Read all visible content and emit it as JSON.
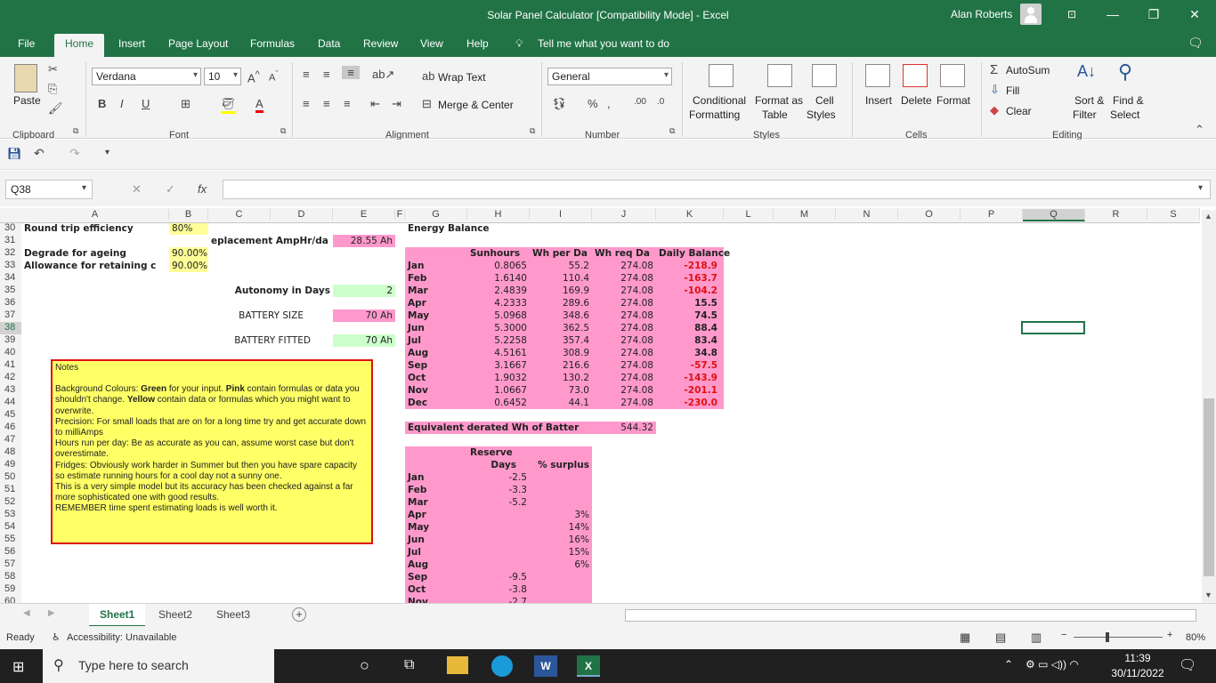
{
  "window": {
    "title": "Solar Panel Calculator  [Compatibility Mode]  -  Excel",
    "user": "Alan Roberts"
  },
  "tabs": [
    "File",
    "Home",
    "Insert",
    "Page Layout",
    "Formulas",
    "Data",
    "Review",
    "View",
    "Help"
  ],
  "tell_me": "Tell me what you want to do",
  "ribbon": {
    "paste": "Paste",
    "clipboard": "Clipboard",
    "font_name": "Verdana",
    "font_size": "10",
    "font": "Font",
    "wrap": "Wrap Text",
    "merge": "Merge & Center",
    "alignment": "Alignment",
    "number_format": "General",
    "number": "Number",
    "cond1": "Conditional",
    "cond2": "Formatting",
    "fmt1": "Format as",
    "fmt2": "Table",
    "cs1": "Cell",
    "cs2": "Styles",
    "styles": "Styles",
    "insert": "Insert",
    "delete": "Delete",
    "format": "Format",
    "cells": "Cells",
    "autosum": "AutoSum",
    "fill": "Fill",
    "clear": "Clear",
    "sort1": "Sort &",
    "sort2": "Filter",
    "find1": "Find &",
    "find2": "Select",
    "editing": "Editing"
  },
  "namebox": "Q38",
  "columns": [
    "A",
    "B",
    "C",
    "D",
    "E",
    "F",
    "G",
    "H",
    "I",
    "J",
    "K",
    "L",
    "M",
    "N",
    "O",
    "P",
    "Q",
    "R",
    "S"
  ],
  "rows": [
    "30",
    "31",
    "32",
    "33",
    "34",
    "35",
    "36",
    "37",
    "38",
    "39",
    "40",
    "41",
    "42",
    "43",
    "44",
    "45",
    "46",
    "47",
    "48",
    "49",
    "50",
    "51",
    "52",
    "53",
    "54",
    "55",
    "56",
    "57",
    "58",
    "59",
    "60"
  ],
  "left": {
    "r30a": "Round trip efficiency",
    "r30b": "80%",
    "r31c": "eplacement AmpHr/da",
    "r31e": "28.55 Ah",
    "r32a": "Degrade for ageing",
    "r32b": "90.00%",
    "r33a": "Allowance for retaining c",
    "r33b": "90.00%",
    "r35d": "Autonomy in Days",
    "r35e": "2",
    "r37d": "BATTERY SIZE",
    "r37e": "70 Ah",
    "r39d": "BATTERY FITTED",
    "r39e": "70 Ah"
  },
  "energy": {
    "title": "Energy  Balance",
    "h_sun": "Sunhours",
    "h_whpd": "Wh per Da",
    "h_whrq": "Wh req Da",
    "h_bal": "Daily Balance",
    "months": [
      "Jan",
      "Feb",
      "Mar",
      "Apr",
      "May",
      "Jun",
      "Jul",
      "Aug",
      "Sep",
      "Oct",
      "Nov",
      "Dec"
    ],
    "sun": [
      "0.8065",
      "1.6140",
      "2.4839",
      "4.2333",
      "5.0968",
      "5.3000",
      "5.2258",
      "4.5161",
      "3.1667",
      "1.9032",
      "1.0667",
      "0.6452"
    ],
    "whpd": [
      "55.2",
      "110.4",
      "169.9",
      "289.6",
      "348.6",
      "362.5",
      "357.4",
      "308.9",
      "216.6",
      "130.2",
      "73.0",
      "44.1"
    ],
    "whrq": [
      "274.08",
      "274.08",
      "274.08",
      "274.08",
      "274.08",
      "274.08",
      "274.08",
      "274.08",
      "274.08",
      "274.08",
      "274.08",
      "274.08"
    ],
    "bal": [
      "-218.9",
      "-163.7",
      "-104.2",
      "15.5",
      "74.5",
      "88.4",
      "83.4",
      "34.8",
      "-57.5",
      "-143.9",
      "-201.1",
      "-230.0"
    ]
  },
  "equiv": {
    "label": "Equivalent derated Wh of Batter",
    "value": "544.32"
  },
  "reserve": {
    "h1": "Reserve",
    "h2": "Days",
    "h3": "% surplus",
    "months": [
      "Jan",
      "Feb",
      "Mar",
      "Apr",
      "May",
      "Jun",
      "Jul",
      "Aug",
      "Sep",
      "Oct",
      "Nov"
    ],
    "days": [
      "-2.5",
      "-3.3",
      "-5.2",
      "",
      "",
      "",
      "",
      "",
      "-9.5",
      "-3.8",
      "-2.7"
    ],
    "surplus": [
      "",
      "",
      "",
      "3%",
      "14%",
      "16%",
      "15%",
      "6%",
      "",
      "",
      ""
    ]
  },
  "notes": {
    "title": "Notes",
    "p1a": "Background Colours: ",
    "p1g": "Green",
    "p1b": " for your input. ",
    "p1p": "Pink",
    "p1c": " contain formulas or data you shouldn't change. ",
    "p1y": "Yellow",
    "p1d": " contain data or formulas which you might want to overwrite.",
    "p2": "Precision: For small loads that are on for a long time try and get accurate down to milliAmps",
    "p3": "Hours run per day: Be as accurate as you can, assume worst case but don't overestimate.",
    "p4": "Fridges: Obviously work harder in Summer but then you have spare capacity so estimate running hours for a cool day not a sunny one.",
    "p5": "This is a very simple model but its accuracy has been checked against a far more sophisticated one with good results.",
    "p6": "REMEMBER time spent estimating loads is well worth it."
  },
  "sheets": [
    "Sheet1",
    "Sheet2",
    "Sheet3"
  ],
  "status": {
    "ready": "Ready",
    "access": "Accessibility: Unavailable",
    "zoom": "80%"
  },
  "taskbar": {
    "search": "Type here to search",
    "time": "11:39",
    "date": "30/11/2022"
  }
}
